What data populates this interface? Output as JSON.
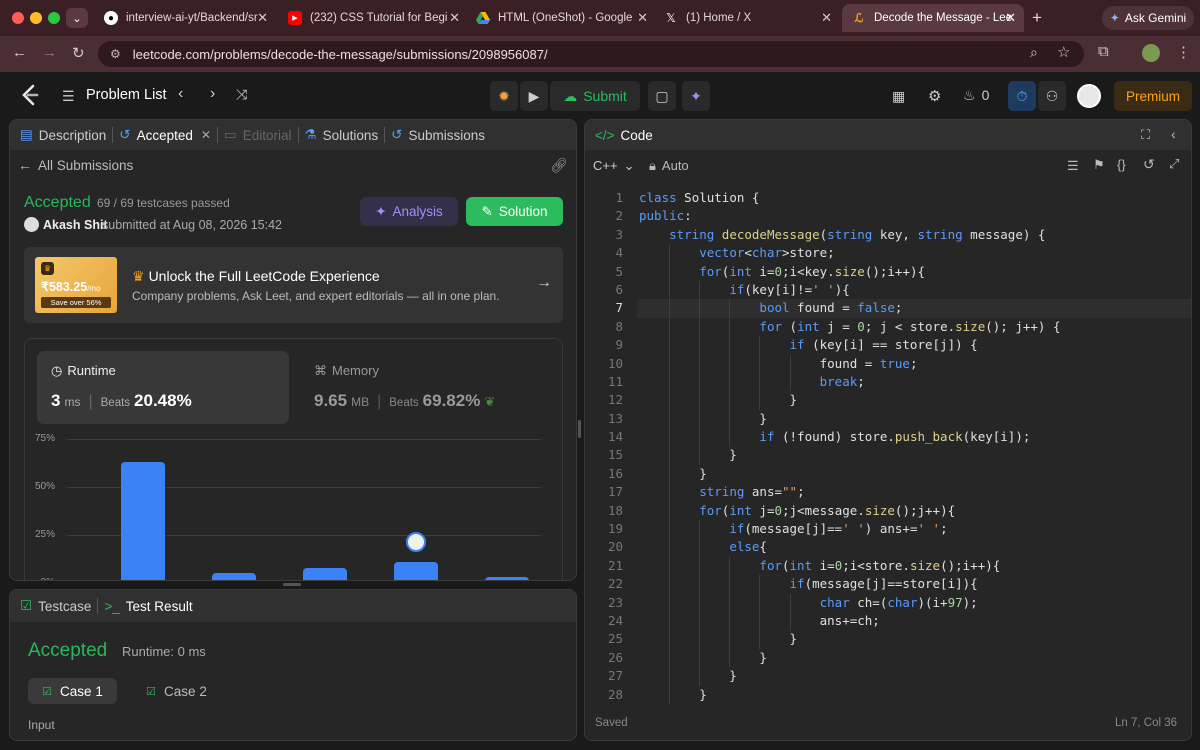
{
  "browser": {
    "tabs": [
      {
        "title": "interview-ai-yt/Backend/sr",
        "icon": "github-icon",
        "color": "#ffffff"
      },
      {
        "title": "(232) CSS Tutorial for Begi",
        "icon": "youtube-icon",
        "color": "#ff0000"
      },
      {
        "title": "HTML (OneShot) - Google",
        "icon": "google-drive-icon",
        "color": "#34a853"
      },
      {
        "title": "(1) Home / X",
        "icon": "x-icon",
        "color": "#000000"
      },
      {
        "title": "Decode the Message - Lee",
        "icon": "leetcode-icon",
        "color": "#ffa116"
      }
    ],
    "new_tab": "+",
    "gemini_label": "Ask Gemini",
    "url": "leetcode.com/problems/decode-the-message/submissions/2098956087/"
  },
  "header": {
    "problem_list": "Problem List",
    "submit_label": "Submit",
    "streak_count": "0",
    "premium_label": "Premium"
  },
  "left_panel": {
    "tabs": [
      "Description",
      "Accepted",
      "Editorial",
      "Solutions",
      "Submissions"
    ],
    "all_submissions": "All Submissions",
    "status": "Accepted",
    "testcases": "69 / 69 testcases passed",
    "user": "Akash Shit",
    "submitted_at": "submitted at Aug 08, 2026 15:42",
    "analysis_label": "Analysis",
    "solution_label": "Solution",
    "promo": {
      "price": "₹583.25",
      "per": "/mo",
      "save": "Save over 56%",
      "title": "Unlock the Full LeetCode Experience",
      "subtitle": "Company problems, Ask Leet, and expert editorials — all in one plan."
    },
    "runtime": {
      "label": "Runtime",
      "value": "3",
      "unit": "ms",
      "beats_label": "Beats",
      "beats": "20.48%"
    },
    "memory": {
      "label": "Memory",
      "value": "9.65",
      "unit": "MB",
      "beats_label": "Beats",
      "beats": "69.82%"
    }
  },
  "chart_data": {
    "type": "bar",
    "yticks": [
      "75%",
      "50%",
      "25%",
      "0%"
    ],
    "ylim": [
      0,
      75
    ],
    "values": [
      63,
      5,
      8,
      11,
      3
    ],
    "highlight_index": 3,
    "grid": true,
    "color": "#3b82f6"
  },
  "bottom_panel": {
    "tabs": [
      "Testcase",
      "Test Result"
    ],
    "status": "Accepted",
    "runtime": "Runtime: 0 ms",
    "cases": [
      "Case 1",
      "Case 2"
    ],
    "input_label": "Input"
  },
  "code_panel": {
    "title": "Code",
    "language": "C++",
    "mode": "Auto",
    "status": "Saved",
    "cursor": "Ln 7, Col 36",
    "active_line": 7,
    "lines": [
      "class Solution {",
      "public:",
      "    string decodeMessage(string key, string message) {",
      "        vector<char>store;",
      "        for(int i=0;i<key.size();i++){",
      "            if(key[i]!=' '){",
      "                bool found = false;",
      "                for (int j = 0; j < store.size(); j++) {",
      "                    if (key[i] == store[j]) {",
      "                        found = true;",
      "                        break;",
      "                    }",
      "                }",
      "                if (!found) store.push_back(key[i]);",
      "            }",
      "        }",
      "        string ans=\"\";",
      "        for(int j=0;j<message.size();j++){",
      "            if(message[j]==' ') ans+=' ';",
      "            else{",
      "                for(int i=0;i<store.size();i++){",
      "                    if(message[j]==store[i]){",
      "                        char ch=(char)(i+97);",
      "                        ans+=ch;",
      "                    }",
      "                }",
      "            }",
      "        }"
    ]
  },
  "colors": {
    "accent_green": "#2cbb5d",
    "accepted": "#2db55d",
    "blue": "#3b82f6",
    "purple": "#8b6cf0",
    "premium": "#ffa116"
  }
}
